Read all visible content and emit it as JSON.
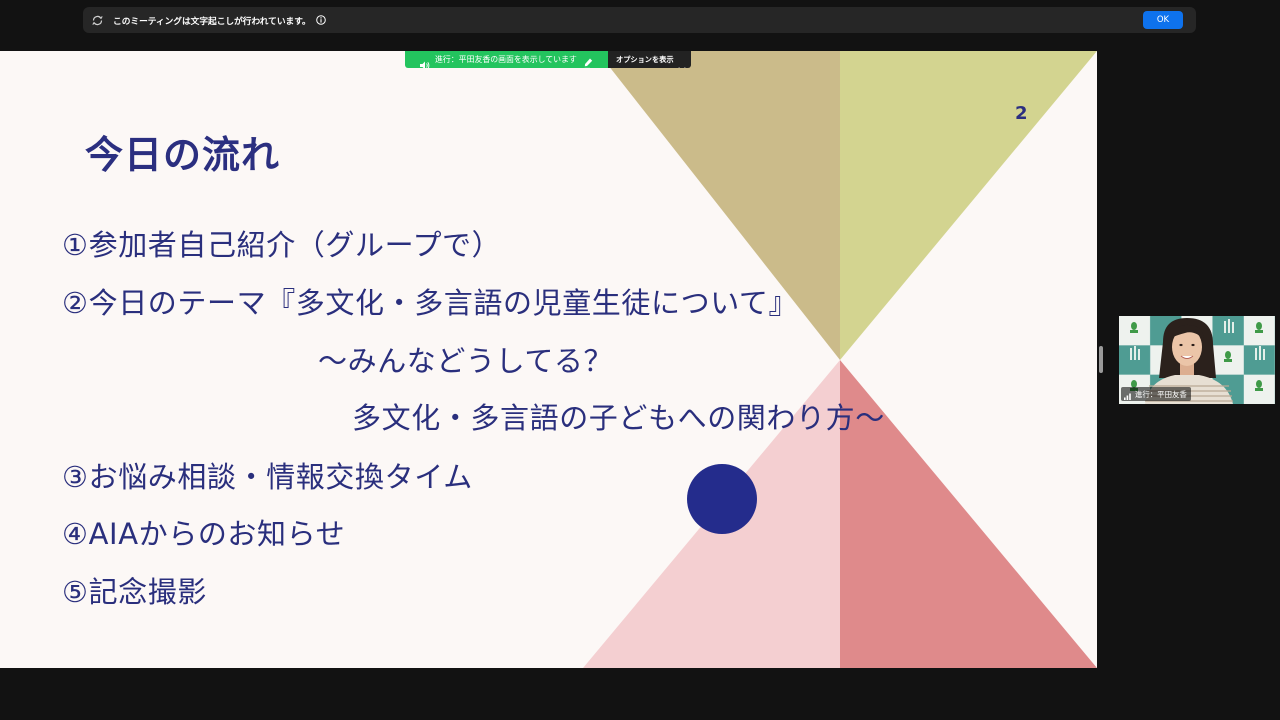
{
  "banner": {
    "transcript_icon": "transcript-icon",
    "message": "このミーティングは文字起こしが行われています。",
    "info_icon": "info-icon",
    "ok_label": "OK"
  },
  "share_bar": {
    "speaker_icon": "speaker-icon",
    "status_text": "進行：平田友香の画面を表示しています",
    "annotate_icon": "annotate-icon",
    "options_label": "オプションを表示",
    "options_icon": "chevron-down-icon"
  },
  "slide": {
    "page_number": "2",
    "title": "今日の流れ",
    "items": [
      "①参加者自己紹介（グループで）",
      "②今日のテーマ『多文化・多言語の児童生徒について』",
      "～みんなどうしてる？",
      "多文化・多言語の子どもへの関わり方～",
      "③お悩み相談・情報交換タイム",
      "④AIAからのお知らせ",
      "⑤記念撮影"
    ],
    "colors": {
      "top_left": "#cbbb8a",
      "top_right": "#d3d490",
      "bottom_left": "#f4cfd1",
      "bottom_right": "#df8a8b",
      "dot": "#242c8c"
    }
  },
  "participant_video": {
    "name_label": "進行：平田友香",
    "signal_icon": "signal-icon"
  }
}
